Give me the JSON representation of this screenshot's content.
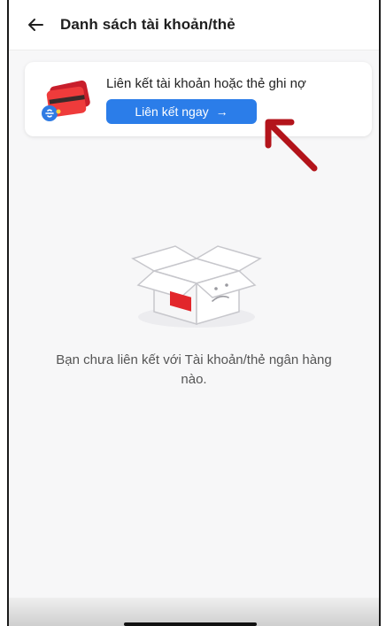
{
  "header": {
    "back_icon": "arrow-left-icon",
    "title": "Danh sách tài khoản/thẻ"
  },
  "link_card": {
    "illustration_icon": "bank-card-link-icon",
    "text": "Liên kết tài khoản hoặc thẻ ghi nợ",
    "button_label": "Liên kết ngay",
    "button_arrow": "→",
    "button_color": "#2b7de9"
  },
  "annotation": {
    "icon": "red-pointer-arrow",
    "color": "#b3141b"
  },
  "empty_state": {
    "illustration_icon": "empty-box-icon",
    "message": "Bạn chưa liên kết với Tài khoản/thẻ ngân hàng nào."
  },
  "system": {
    "home_indicator_icon": "home-indicator"
  }
}
